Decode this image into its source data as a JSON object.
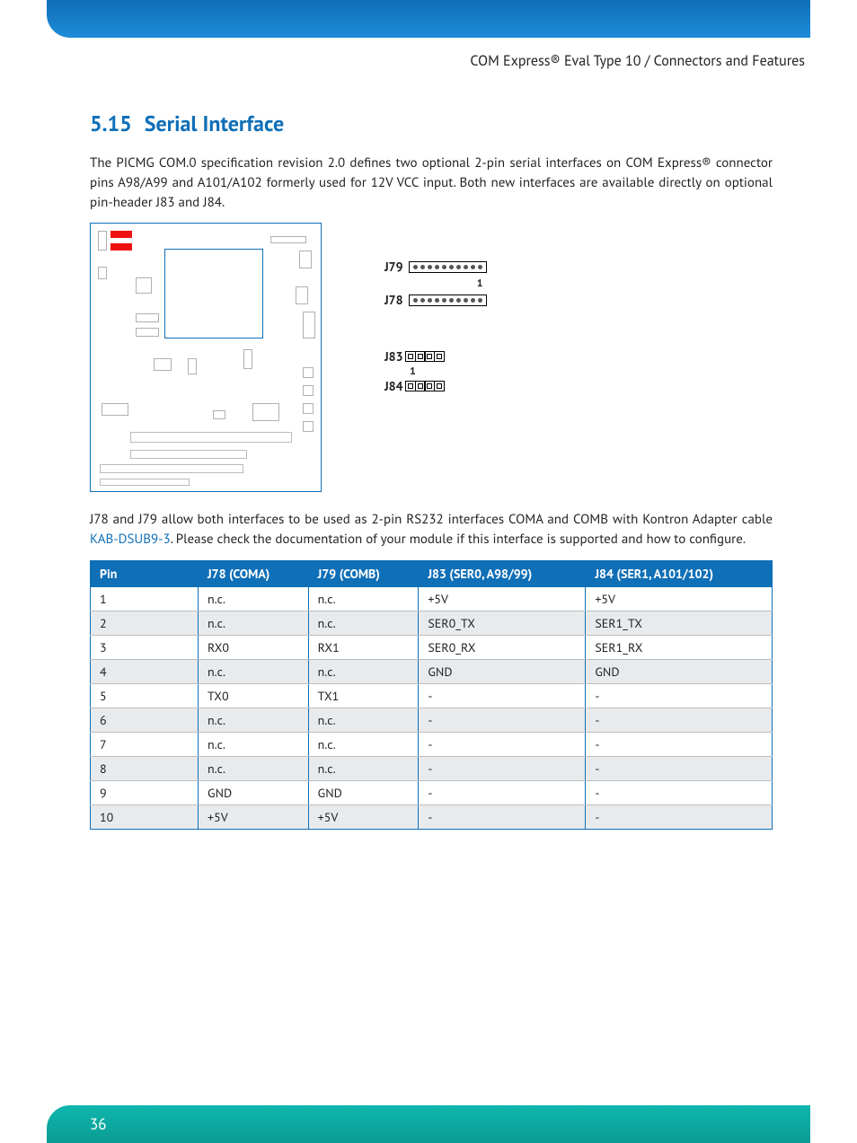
{
  "header": {
    "trail": "COM Express® Eval Type 10 / Connectors and Features"
  },
  "section": {
    "number": "5.15",
    "title": "Serial Interface"
  },
  "para1": "The PICMG COM.0 specification revision 2.0 defines two optional 2-pin serial interfaces on COM Express® connector pins A98/A99 and A101/A102 formerly used for 12V VCC input. Both new interfaces are available directly on optional pin-header J83 and J84.",
  "para2_pre": "J78 and J79 allow both interfaces to be used as 2-pin RS232 interfaces COMA and COMB with Kontron Adapter cable ",
  "para2_link": "KAB-DSUB9-3",
  "para2_post": ". Please check the documentation of your module if this interface is supported and how to configure.",
  "connectors": {
    "j79": "J79",
    "j78": "J78",
    "j83": "J83",
    "j84": "J84",
    "pin1": "1"
  },
  "table": {
    "headers": [
      "Pin",
      "J78 (COMA)",
      "J79 (COMB)",
      "J83 (SER0, A98/99)",
      "J84 (SER1, A101/102)"
    ],
    "rows": [
      [
        "1",
        "n.c.",
        "n.c.",
        "+5V",
        "+5V"
      ],
      [
        "2",
        "n.c.",
        "n.c.",
        "SER0_TX",
        "SER1_TX"
      ],
      [
        "3",
        "RX0",
        "RX1",
        "SER0_RX",
        "SER1_RX"
      ],
      [
        "4",
        "n.c.",
        "n.c.",
        "GND",
        "GND"
      ],
      [
        "5",
        "TX0",
        "TX1",
        "-",
        "-"
      ],
      [
        "6",
        "n.c.",
        "n.c.",
        "-",
        "-"
      ],
      [
        "7",
        "n.c.",
        "n.c.",
        "-",
        "-"
      ],
      [
        "8",
        "n.c.",
        "n.c.",
        "-",
        "-"
      ],
      [
        "9",
        "GND",
        "GND",
        "-",
        "-"
      ],
      [
        "10",
        "+5V",
        "+5V",
        "-",
        "-"
      ]
    ]
  },
  "footer": {
    "page": "36"
  }
}
